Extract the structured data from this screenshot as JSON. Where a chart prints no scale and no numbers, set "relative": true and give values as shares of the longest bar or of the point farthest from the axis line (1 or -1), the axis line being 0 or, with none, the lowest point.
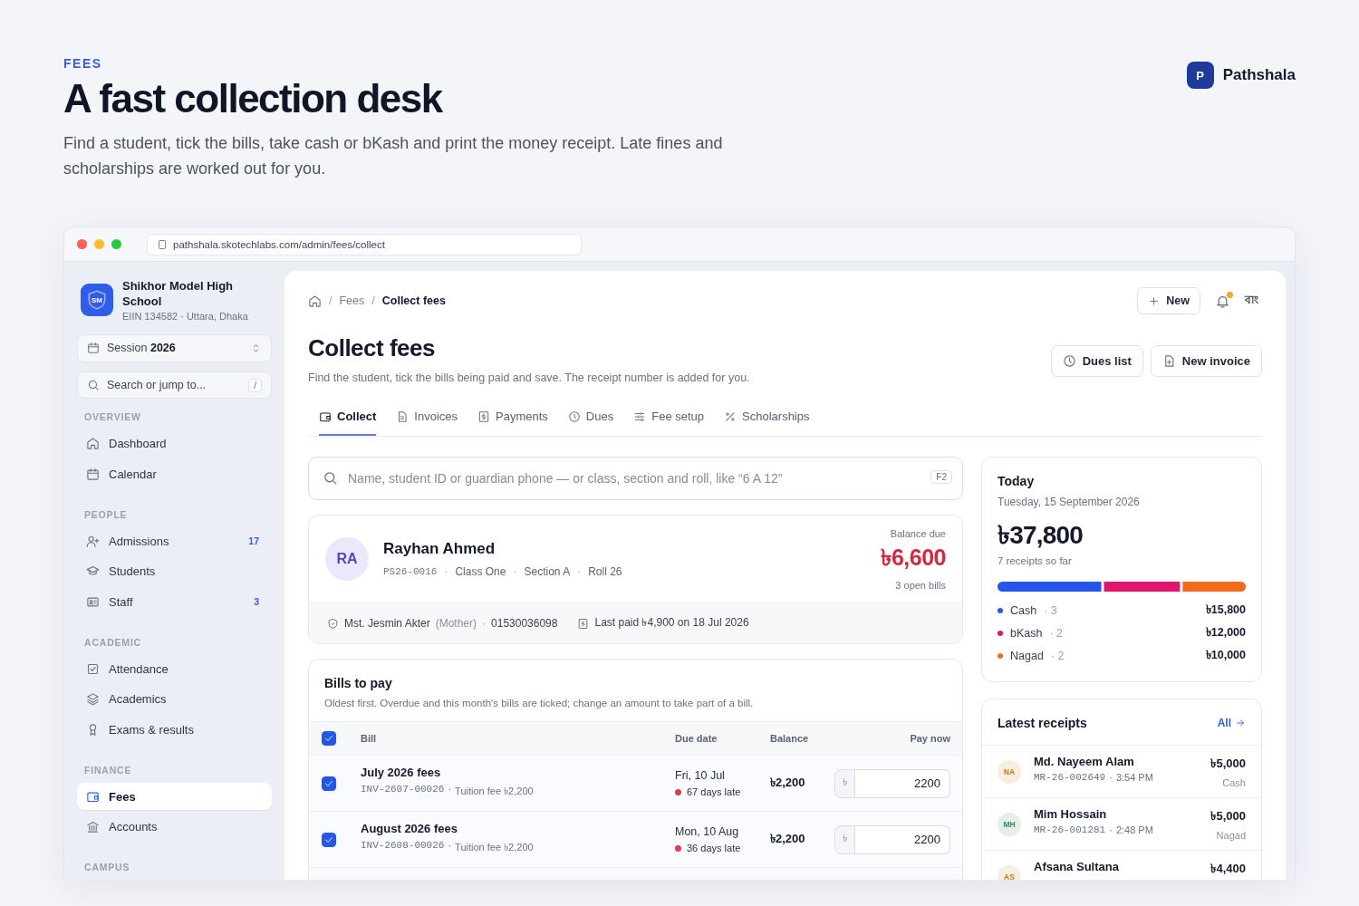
{
  "hero": {
    "eyebrow": "FEES",
    "title": "A fast collection desk",
    "description": "Find a student, tick the bills, take cash or bKash and print the money receipt. Late fines and scholarships are worked out for you."
  },
  "brand": {
    "initial": "P",
    "name": "Pathshala"
  },
  "browser": {
    "url": "pathshala.skotechlabs.com/admin/fees/collect"
  },
  "sidebar": {
    "school": {
      "initials": "SM",
      "name": "Shikhor Model High School",
      "meta": "EIIN 134582 · Uttara, Dhaka"
    },
    "session": {
      "label": "Session",
      "value": "2026"
    },
    "search": {
      "placeholder": "Search or jump to...",
      "shortcut": "/"
    },
    "sections": [
      {
        "title": "OVERVIEW",
        "items": [
          {
            "label": "Dashboard",
            "selected": false
          },
          {
            "label": "Calendar",
            "selected": false
          }
        ]
      },
      {
        "title": "PEOPLE",
        "items": [
          {
            "label": "Admissions",
            "badge": "17",
            "selected": false
          },
          {
            "label": "Students",
            "selected": false
          },
          {
            "label": "Staff",
            "badge": "3",
            "selected": false
          }
        ]
      },
      {
        "title": "ACADEMIC",
        "items": [
          {
            "label": "Attendance",
            "selected": false
          },
          {
            "label": "Academics",
            "selected": false
          },
          {
            "label": "Exams & results",
            "selected": false
          }
        ]
      },
      {
        "title": "FINANCE",
        "items": [
          {
            "label": "Fees",
            "selected": true
          },
          {
            "label": "Accounts",
            "selected": false
          }
        ]
      },
      {
        "title": "CAMPUS"
      }
    ]
  },
  "topbar": {
    "breadcrumb": [
      {
        "separator": "/",
        "label": "Fees"
      },
      {
        "separator": "/",
        "label": "Collect fees"
      }
    ],
    "new_button": "New",
    "notifications_unread": true,
    "language": "বাং"
  },
  "page": {
    "title": "Collect fees",
    "subtitle": "Find the student, tick the bills being paid and save. The receipt number is added for you.",
    "actions": [
      "Dues list",
      "New invoice"
    ],
    "tabs": [
      {
        "label": "Collect",
        "selected": true
      },
      {
        "label": "Invoices",
        "selected": false
      },
      {
        "label": "Payments",
        "selected": false
      },
      {
        "label": "Dues",
        "selected": false
      },
      {
        "label": "Fee setup",
        "selected": false
      },
      {
        "label": "Scholarships",
        "selected": false
      }
    ]
  },
  "student_search": {
    "placeholder": "Name, student ID or guardian phone — or class, section and roll, like “6 A 12”",
    "shortcut": "F2"
  },
  "student": {
    "initials": "RA",
    "name": "Rayhan Ahmed",
    "id": "PS26-0016",
    "details": [
      {
        "separator": "·",
        "text": "Class One"
      },
      {
        "separator": "·",
        "text": "Section A"
      },
      {
        "separator": "·",
        "text": "Roll 26"
      }
    ],
    "balance_label": "Balance due",
    "balance": "৳6,600",
    "open_bills": "3 open bills",
    "guardian": "Mst. Jesmin Akter",
    "relation": "(Mother)",
    "phone_separator": "·",
    "phone": "01530036098",
    "last_paid": "Last paid ৳4,900 on 18 Jul 2026"
  },
  "bills": {
    "title": "Bills to pay",
    "description": "Oldest first. Overdue and this month's bills are ticked; change an amount to take part of a bill.",
    "all_checked": true,
    "columns": [
      "Bill",
      "Due date",
      "Balance",
      "Pay now"
    ],
    "rows": [
      {
        "checked": true,
        "title": "July 2026 fees",
        "invoice": "INV-2607-00026",
        "separator": "·",
        "detail": "Tuition fee ৳2,200",
        "due": "Fri, 10 Jul",
        "late": "67 days late",
        "balance": "৳2,200",
        "currency": "৳",
        "pay": "2200"
      },
      {
        "checked": true,
        "title": "August 2026 fees",
        "invoice": "INV-2608-00026",
        "separator": "·",
        "detail": "Tuition fee ৳2,200",
        "due": "Mon, 10 Aug",
        "late": "36 days late",
        "balance": "৳2,200",
        "currency": "৳",
        "pay": "2200"
      }
    ]
  },
  "today": {
    "title": "Today",
    "date": "Tuesday, 15 September 2026",
    "total": "৳37,800",
    "note": "7 receipts so far",
    "chart_data": {
      "type": "bar",
      "orientation": "horizontal",
      "stacked": true,
      "relative": true,
      "series": [
        {
          "name": "Cash",
          "color": "#2457e6",
          "values": [
            0.418
          ]
        },
        {
          "name": "bKash",
          "color": "#e0166e",
          "values": [
            0.317
          ]
        },
        {
          "name": "Nagad",
          "color": "#f26b1d",
          "values": [
            0.265
          ]
        }
      ]
    },
    "methods": [
      {
        "count": "· 3",
        "amount": "৳15,800"
      },
      {
        "count": "· 2",
        "amount": "৳12,000"
      },
      {
        "count": "· 2",
        "amount": "৳10,000"
      }
    ]
  },
  "receipts": {
    "title": "Latest receipts",
    "all_link": "All",
    "items": [
      {
        "initials": "NA",
        "color": "#c27a1a",
        "name": "Md. Nayeem Alam",
        "number": "MR-26-002649",
        "separator": "·",
        "time": "3:54 PM",
        "amount": "৳5,000",
        "method": "Cash"
      },
      {
        "initials": "MH",
        "color": "#2f8a55",
        "name": "Mim Hossain",
        "number": "MR-26-001281",
        "separator": "·",
        "time": "2:48 PM",
        "amount": "৳5,000",
        "method": "Nagad"
      },
      {
        "initials": "AS",
        "color": "#c27a1a",
        "name": "Afsana Sultana",
        "amount": "৳4,400"
      }
    ]
  }
}
